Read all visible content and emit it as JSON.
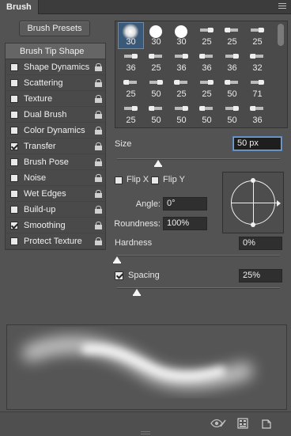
{
  "panel": {
    "tab_label": "Brush"
  },
  "presets_button": "Brush Presets",
  "options": {
    "header": "Brush Tip Shape",
    "items": [
      {
        "label": "Shape Dynamics",
        "checked": false
      },
      {
        "label": "Scattering",
        "checked": false
      },
      {
        "label": "Texture",
        "checked": false
      },
      {
        "label": "Dual Brush",
        "checked": false
      },
      {
        "label": "Color Dynamics",
        "checked": false
      },
      {
        "label": "Transfer",
        "checked": true
      },
      {
        "label": "Brush Pose",
        "checked": false
      },
      {
        "label": "Noise",
        "checked": false
      },
      {
        "label": "Wet Edges",
        "checked": false
      },
      {
        "label": "Build-up",
        "checked": false
      },
      {
        "label": "Smoothing",
        "checked": true
      },
      {
        "label": "Protect Texture",
        "checked": false
      }
    ]
  },
  "tips": {
    "rows": [
      [
        "30",
        "30",
        "30",
        "25",
        "25",
        "25"
      ],
      [
        "36",
        "25",
        "36",
        "36",
        "36",
        "32"
      ],
      [
        "25",
        "50",
        "25",
        "25",
        "50",
        "71"
      ],
      [
        "25",
        "50",
        "50",
        "50",
        "50",
        "36"
      ]
    ],
    "selected": "30"
  },
  "size": {
    "label": "Size",
    "value": "50 px",
    "slider_fraction": 0.25
  },
  "flip_x": {
    "label": "Flip X",
    "checked": false
  },
  "flip_y": {
    "label": "Flip Y",
    "checked": false
  },
  "angle": {
    "label": "Angle:",
    "value": "0°"
  },
  "roundness": {
    "label": "Roundness:",
    "value": "100%"
  },
  "hardness": {
    "label": "Hardness",
    "value": "0%",
    "slider_fraction": 0.0
  },
  "spacing": {
    "label": "Spacing",
    "value": "25%",
    "checked": true,
    "slider_fraction": 0.12
  },
  "footer_icons": [
    "eye-toggle-icon",
    "grid-icon",
    "new-preset-icon"
  ]
}
